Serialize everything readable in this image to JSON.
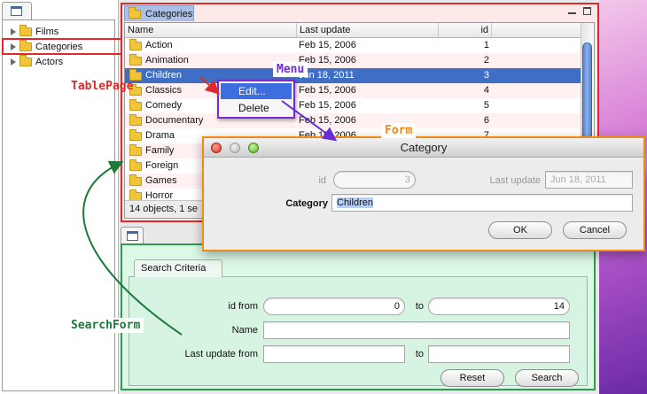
{
  "tree": {
    "items": [
      {
        "label": "Films",
        "icon": "folder-icon",
        "selected": false
      },
      {
        "label": "Categories",
        "icon": "folder-icon",
        "selected": true
      },
      {
        "label": "Actors",
        "icon": "folder-icon",
        "selected": false
      }
    ]
  },
  "table": {
    "tab_label": "Categories",
    "columns": [
      "Name",
      "Last update",
      "id"
    ],
    "rows": [
      {
        "name": "Action",
        "last_update": "Feb 15, 2006",
        "id": "1"
      },
      {
        "name": "Animation",
        "last_update": "Feb 15, 2006",
        "id": "2"
      },
      {
        "name": "Children",
        "last_update": "Jun 18, 2011",
        "id": "3",
        "selected": true
      },
      {
        "name": "Classics",
        "last_update": "Feb 15, 2006",
        "id": "4"
      },
      {
        "name": "Comedy",
        "last_update": "Feb 15, 2006",
        "id": "5"
      },
      {
        "name": "Documentary",
        "last_update": "Feb 15, 2006",
        "id": "6"
      },
      {
        "name": "Drama",
        "last_update": "Feb 15, 2006",
        "id": "7"
      },
      {
        "name": "Family",
        "last_update": "",
        "id": ""
      },
      {
        "name": "Foreign",
        "last_update": "",
        "id": ""
      },
      {
        "name": "Games",
        "last_update": "",
        "id": ""
      },
      {
        "name": "Horror",
        "last_update": "",
        "id": ""
      }
    ],
    "status": "14 objects, 1 se"
  },
  "context_menu": {
    "items": [
      "Edit...",
      "Delete"
    ],
    "highlighted": "Edit..."
  },
  "form": {
    "title": "Category",
    "id_label": "id",
    "id_value": "3",
    "last_update_label": "Last update",
    "last_update_value": "Jun 18, 2011",
    "category_label": "Category",
    "category_value": "Children",
    "ok_label": "OK",
    "cancel_label": "Cancel"
  },
  "search": {
    "tab_label": "Search Criteria",
    "id_from_label": "id from",
    "id_from_value": "0",
    "to_label": "to",
    "id_to_value": "14",
    "name_label": "Name",
    "name_value": "",
    "last_update_from_label": "Last update from",
    "last_update_from_value": "",
    "last_update_to_value": "",
    "reset_label": "Reset",
    "search_label": "Search"
  },
  "annotations": {
    "tablepage": "TablePage",
    "menu": "Menu",
    "form": "Form",
    "searchform": "SearchForm"
  },
  "colors": {
    "tablepage": "#e02a2a",
    "menu": "#6a2cd6",
    "form": "#f08a12",
    "searchform": "#1c7a3a",
    "selection": "#3f6ec5"
  }
}
